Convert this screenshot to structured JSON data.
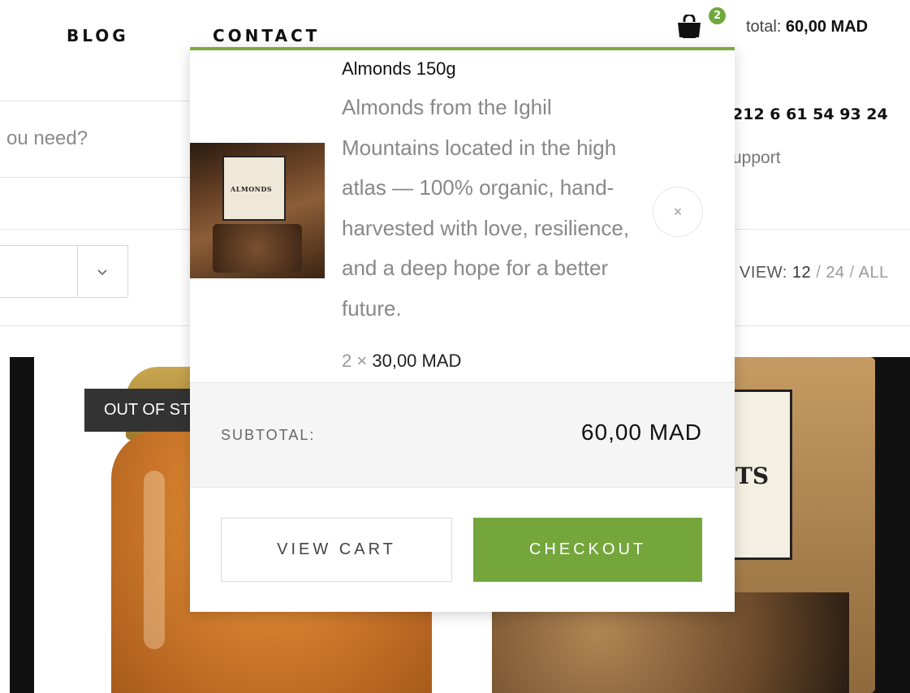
{
  "nav": {
    "blog": "BLOG",
    "contact": "CONTACT"
  },
  "cart": {
    "count": "2",
    "total_prefix": "total:",
    "total_value": "60,00 MAD"
  },
  "search": {
    "placeholder_fragment": "ou need?"
  },
  "contact": {
    "phone": "212 6 61 54 93 24",
    "support": "upport"
  },
  "view": {
    "label": "VIEW:",
    "options": [
      "12",
      "24",
      "ALL"
    ],
    "separator": "/"
  },
  "badges": {
    "out_of_stock": "OUT OF ST"
  },
  "product_images": {
    "right_label": "TS"
  },
  "mini_cart": {
    "item": {
      "name": "Almonds 150g",
      "description": "Almonds from the Ighil Mountains located in the high atlas — 100% organic, hand-harvested with love, resilience, and a deep hope for a better future.",
      "quantity": "2",
      "times": "×",
      "unit_price": "30,00 MAD",
      "thumb_label": "ALMONDS"
    },
    "remove_symbol": "×",
    "subtotal_label": "SUBTOTAL:",
    "subtotal_value": "60,00 MAD",
    "view_cart_label": "VIEW CART",
    "checkout_label": "CHECKOUT"
  },
  "colors": {
    "accent_green": "#74a63c",
    "badge_dark": "#333333"
  },
  "icons": [
    "shopping-bag-icon",
    "chevron-down-icon",
    "close-icon"
  ]
}
